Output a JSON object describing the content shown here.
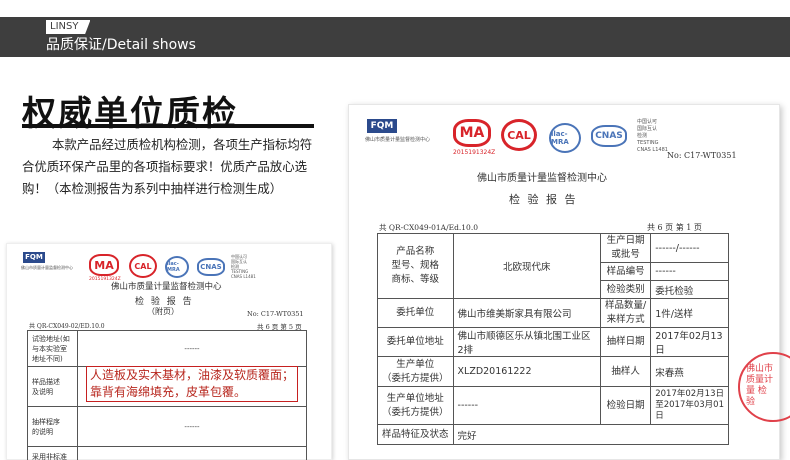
{
  "header": {
    "brand": "LINSY",
    "title": "品质保证/Detail shows"
  },
  "intro": {
    "heading": "权威单位质检",
    "body": "本款产品经过质检机构检测，各项生产指标均符合优质环保产品里的各项指标要求！优质产品放心选购！（本检测报告为系列中抽样进行检测生成）"
  },
  "report_right": {
    "fqm": "FQM",
    "fqm_caption": "佛山市质量计量监督检测中心",
    "ma_number": "2015191324Z",
    "cnas_caption": "中国认可\n国际互认\n检测\nTESTING\nCNAS L1481",
    "report_no": "No: C17-WT0351",
    "center": "佛山市质量计量监督检测中心",
    "doc_title": "检 验 报 告",
    "form_code": "共 QR-CX049-01A/Ed.10.0",
    "pages": "共 6 页  第 1 页",
    "rows": [
      {
        "label": "产品名称\n型号、规格\n商标、等级",
        "value": "北欧现代床",
        "right": [
          {
            "label": "生产日期\n或批号",
            "value": "------/------"
          },
          {
            "label": "样品编号",
            "value": "------"
          },
          {
            "label": "检验类别",
            "value": "委托检验"
          }
        ]
      },
      {
        "label": "委托单位",
        "value": "佛山市维美斯家具有限公司",
        "rlabel": "样品数量/\n来样方式",
        "rvalue": "1件/送样"
      },
      {
        "label": "委托单位地址",
        "value": "佛山市顺德区乐从镇北围工业区2排",
        "rlabel": "抽样日期",
        "rvalue": "2017年02月13日"
      },
      {
        "label": "生产单位\n（委托方提供）",
        "value": "XLZD20161222",
        "rlabel": "抽样人",
        "rvalue": "宋春燕"
      },
      {
        "label": "生产单位地址\n（委托方提供）",
        "value": "------",
        "rlabel": "检验日期",
        "rvalue": "2017年02月13日\n至2017年03月01\n日"
      },
      {
        "label": "样品特征及状态",
        "value": "完好"
      }
    ],
    "stamp_text": "佛山市质量计量 检验"
  },
  "report_left": {
    "fqm": "FQM",
    "fqm_caption": "佛山市质量计量监督检测中心",
    "ma_number": "2015191324Z",
    "cnas_caption": "中国认可\n国际互认\n检测\nTESTING\nCNAS L1481",
    "center": "佛山市质量计量监督检测中心",
    "doc_title": "检 验 报 告",
    "appendix": "（附页）",
    "report_no": "No: C17-WT0351",
    "form_code": "共 QR-CX049-02/ED.10.0",
    "pages": "共 6 页  第 5 页",
    "rows": [
      {
        "label": "试验地址(如\n与本实验室\n地址不同)",
        "value": "------"
      },
      {
        "label": "样品描述\n及说明",
        "value": ""
      },
      {
        "label": "抽样程序\n的说明",
        "value": "------"
      },
      {
        "label": "采用非标准\n方法的说明",
        "value": ""
      }
    ],
    "highlight": [
      "人造板及实木基材，油漆及软质覆面；",
      "靠背有海绵填充，皮革包覆。"
    ]
  }
}
